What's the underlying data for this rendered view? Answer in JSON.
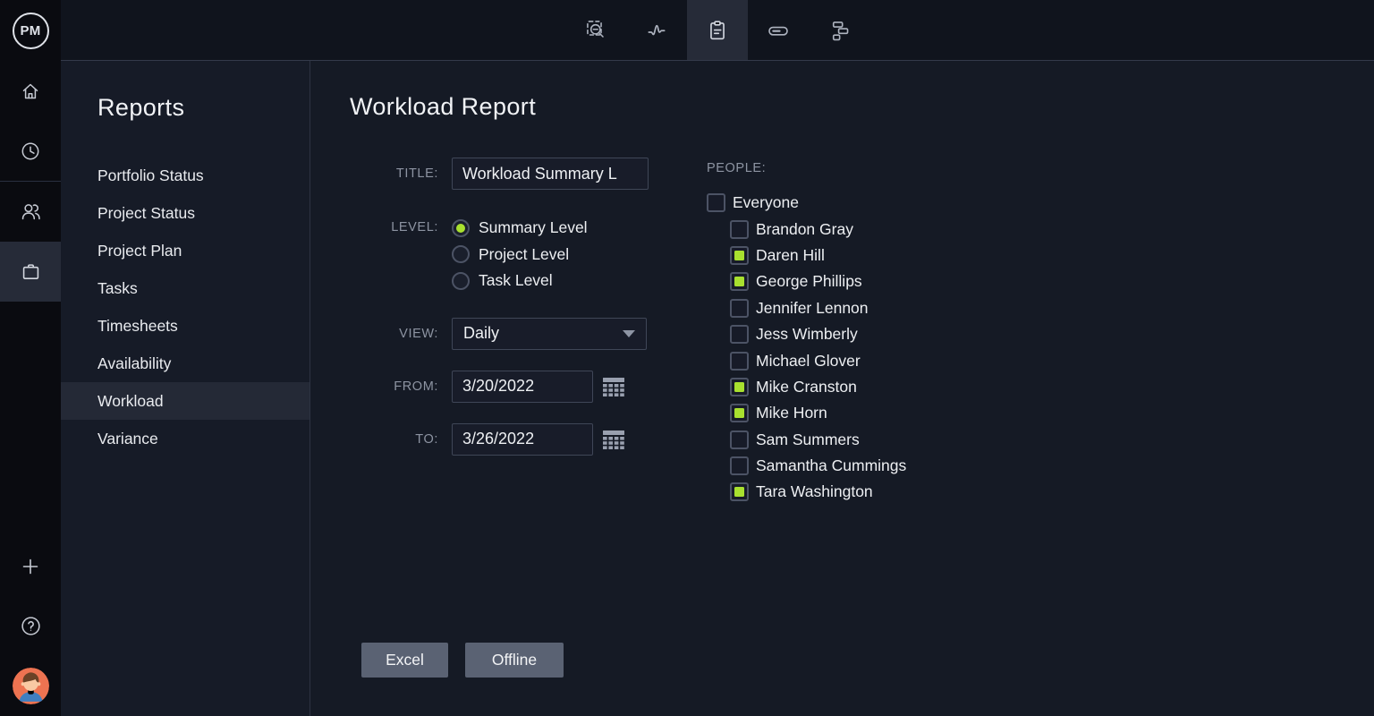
{
  "brand": {
    "logo_text": "PM"
  },
  "colors": {
    "accent_green": "#a8e02f",
    "button_bg": "#5a6273",
    "active_tile": "#262b38",
    "sidebar_active_row": "#242936"
  },
  "topbar": {
    "icons": [
      {
        "name": "search-select-icon",
        "active": false
      },
      {
        "name": "activity-pulse-icon",
        "active": false
      },
      {
        "name": "reports-clipboard-icon",
        "active": true
      },
      {
        "name": "task-bar-icon",
        "active": false
      },
      {
        "name": "workflow-blocks-icon",
        "active": false
      }
    ]
  },
  "rail": {
    "items": [
      {
        "name": "home",
        "active": false
      },
      {
        "name": "time",
        "active": false
      },
      {
        "name": "team",
        "active": false
      },
      {
        "name": "projects",
        "active": true
      }
    ],
    "bottom_items": [
      {
        "name": "add",
        "active": false
      },
      {
        "name": "help",
        "active": false
      },
      {
        "name": "profile",
        "active": false
      }
    ]
  },
  "sidebar": {
    "title": "Reports",
    "items": [
      {
        "label": "Portfolio Status",
        "active": false
      },
      {
        "label": "Project Status",
        "active": false
      },
      {
        "label": "Project Plan",
        "active": false
      },
      {
        "label": "Tasks",
        "active": false
      },
      {
        "label": "Timesheets",
        "active": false
      },
      {
        "label": "Availability",
        "active": false
      },
      {
        "label": "Workload",
        "active": true
      },
      {
        "label": "Variance",
        "active": false
      }
    ]
  },
  "main": {
    "title": "Workload Report",
    "form": {
      "title_label": "TITLE:",
      "title_value": "Workload Summary L",
      "level_label": "LEVEL:",
      "levels": [
        {
          "label": "Summary Level",
          "selected": true
        },
        {
          "label": "Project Level",
          "selected": false
        },
        {
          "label": "Task Level",
          "selected": false
        }
      ],
      "view_label": "VIEW:",
      "view_value": "Daily",
      "from_label": "FROM:",
      "from_value": "3/20/2022",
      "to_label": "TO:",
      "to_value": "3/26/2022"
    },
    "people": {
      "label": "PEOPLE:",
      "everyone": {
        "label": "Everyone",
        "checked": false
      },
      "members": [
        {
          "name": "Brandon Gray",
          "checked": false
        },
        {
          "name": "Daren Hill",
          "checked": true
        },
        {
          "name": "George Phillips",
          "checked": true
        },
        {
          "name": "Jennifer Lennon",
          "checked": false
        },
        {
          "name": "Jess Wimberly",
          "checked": false
        },
        {
          "name": "Michael Glover",
          "checked": false
        },
        {
          "name": "Mike Cranston",
          "checked": true
        },
        {
          "name": "Mike Horn",
          "checked": true
        },
        {
          "name": "Sam Summers",
          "checked": false
        },
        {
          "name": "Samantha Cummings",
          "checked": false
        },
        {
          "name": "Tara Washington",
          "checked": true
        }
      ]
    },
    "buttons": {
      "excel": "Excel",
      "offline": "Offline"
    }
  }
}
